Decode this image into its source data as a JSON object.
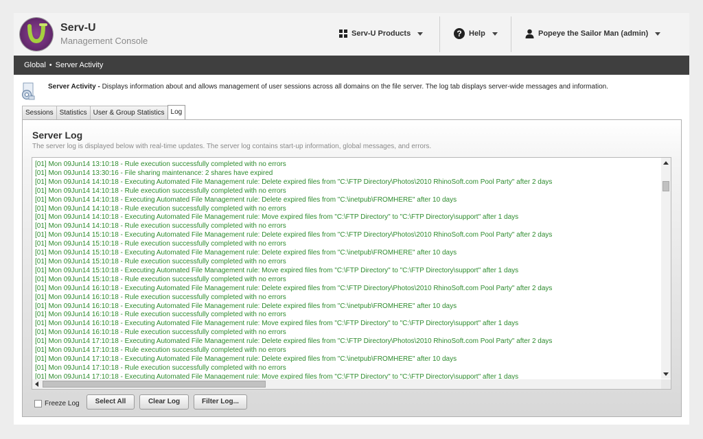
{
  "app": {
    "title": "Serv-U",
    "subtitle": "Management Console"
  },
  "header": {
    "products_label": "Serv-U Products",
    "help_label": "Help",
    "user_label": "Popeye the Sailor Man (admin)"
  },
  "breadcrumb": {
    "items": [
      "Global",
      "Server Activity"
    ],
    "separator": "•"
  },
  "description": {
    "title": "Server Activity -",
    "text": "Displays information about and allows management of user sessions across all domains on the file server. The log tab displays server-wide messages and information."
  },
  "tabs": [
    {
      "label": "Sessions",
      "active": false
    },
    {
      "label": "Statistics",
      "active": false
    },
    {
      "label": "User & Group Statistics",
      "active": false
    },
    {
      "label": "Log",
      "active": true
    }
  ],
  "log_panel": {
    "title": "Server Log",
    "subtitle": "The server log is displayed below with real-time updates. The server log contains start-up information, global messages, and errors.",
    "text_color": "#2e8b2e",
    "lines": [
      "[01] Mon 09Jun14 13:10:18 - Rule execution successfully completed with no errors",
      "[01] Mon 09Jun14 13:30:16 - File sharing maintenance: 2 shares have expired",
      "[01] Mon 09Jun14 14:10:18 - Executing Automated File Management rule: Delete expired files from \"C:\\FTP Directory\\Photos\\2010 RhinoSoft.com Pool Party\" after 2 days",
      "[01] Mon 09Jun14 14:10:18 - Rule execution successfully completed with no errors",
      "[01] Mon 09Jun14 14:10:18 - Executing Automated File Management rule: Delete expired files from \"C:\\inetpub\\FROMHERE\" after 10 days",
      "[01] Mon 09Jun14 14:10:18 - Rule execution successfully completed with no errors",
      "[01] Mon 09Jun14 14:10:18 - Executing Automated File Management rule: Move expired files from \"C:\\FTP Directory\" to \"C:\\FTP Directory\\support\" after 1 days",
      "[01] Mon 09Jun14 14:10:18 - Rule execution successfully completed with no errors",
      "[01] Mon 09Jun14 15:10:18 - Executing Automated File Management rule: Delete expired files from \"C:\\FTP Directory\\Photos\\2010 RhinoSoft.com Pool Party\" after 2 days",
      "[01] Mon 09Jun14 15:10:18 - Rule execution successfully completed with no errors",
      "[01] Mon 09Jun14 15:10:18 - Executing Automated File Management rule: Delete expired files from \"C:\\inetpub\\FROMHERE\" after 10 days",
      "[01] Mon 09Jun14 15:10:18 - Rule execution successfully completed with no errors",
      "[01] Mon 09Jun14 15:10:18 - Executing Automated File Management rule: Move expired files from \"C:\\FTP Directory\" to \"C:\\FTP Directory\\support\" after 1 days",
      "[01] Mon 09Jun14 15:10:18 - Rule execution successfully completed with no errors",
      "[01] Mon 09Jun14 16:10:18 - Executing Automated File Management rule: Delete expired files from \"C:\\FTP Directory\\Photos\\2010 RhinoSoft.com Pool Party\" after 2 days",
      "[01] Mon 09Jun14 16:10:18 - Rule execution successfully completed with no errors",
      "[01] Mon 09Jun14 16:10:18 - Executing Automated File Management rule: Delete expired files from \"C:\\inetpub\\FROMHERE\" after 10 days",
      "[01] Mon 09Jun14 16:10:18 - Rule execution successfully completed with no errors",
      "[01] Mon 09Jun14 16:10:18 - Executing Automated File Management rule: Move expired files from \"C:\\FTP Directory\" to \"C:\\FTP Directory\\support\" after 1 days",
      "[01] Mon 09Jun14 16:10:18 - Rule execution successfully completed with no errors",
      "[01] Mon 09Jun14 17:10:18 - Executing Automated File Management rule: Delete expired files from \"C:\\FTP Directory\\Photos\\2010 RhinoSoft.com Pool Party\" after 2 days",
      "[01] Mon 09Jun14 17:10:18 - Rule execution successfully completed with no errors",
      "[01] Mon 09Jun14 17:10:18 - Executing Automated File Management rule: Delete expired files from \"C:\\inetpub\\FROMHERE\" after 10 days",
      "[01] Mon 09Jun14 17:10:18 - Rule execution successfully completed with no errors",
      "[01] Mon 09Jun14 17:10:18 - Executing Automated File Management rule: Move expired files from \"C:\\FTP Directory\" to \"C:\\FTP Directory\\support\" after 1 days"
    ]
  },
  "controls": {
    "freeze_label": "Freeze Log",
    "freeze_checked": false,
    "select_all_label": "Select All",
    "clear_log_label": "Clear Log",
    "filter_log_label": "Filter Log..."
  },
  "icons": {
    "products": "grid-icon",
    "help": "question-circle-icon",
    "user": "user-icon",
    "description": "server-gear-icon",
    "logo": "serv-u-logo"
  }
}
